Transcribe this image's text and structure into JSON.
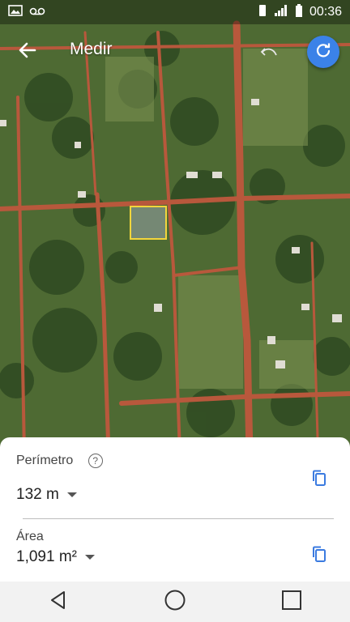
{
  "status_bar": {
    "time": "00:36",
    "left_icons": [
      "image-icon",
      "voicemail-icon"
    ],
    "right_icons": [
      "vibrate-icon",
      "signal-icon",
      "battery-icon"
    ]
  },
  "app_bar": {
    "title": "Medir",
    "back_icon": "arrow-back-icon",
    "undo_icon": "undo-icon",
    "refresh_icon": "refresh-icon",
    "accent_color": "#3b82e8"
  },
  "measurement_sheet": {
    "perimeter": {
      "label": "Perímetro",
      "value": "132 m",
      "help_icon": "help-icon",
      "copy_icon": "copy-icon"
    },
    "area": {
      "label": "Área",
      "value": "1,091 m²",
      "copy_icon": "copy-icon"
    }
  },
  "nav_bar": {
    "buttons": [
      "back-triangle-icon",
      "home-circle-icon",
      "recents-square-icon"
    ]
  },
  "map": {
    "measured_polygon_color": "#f2d53c"
  }
}
